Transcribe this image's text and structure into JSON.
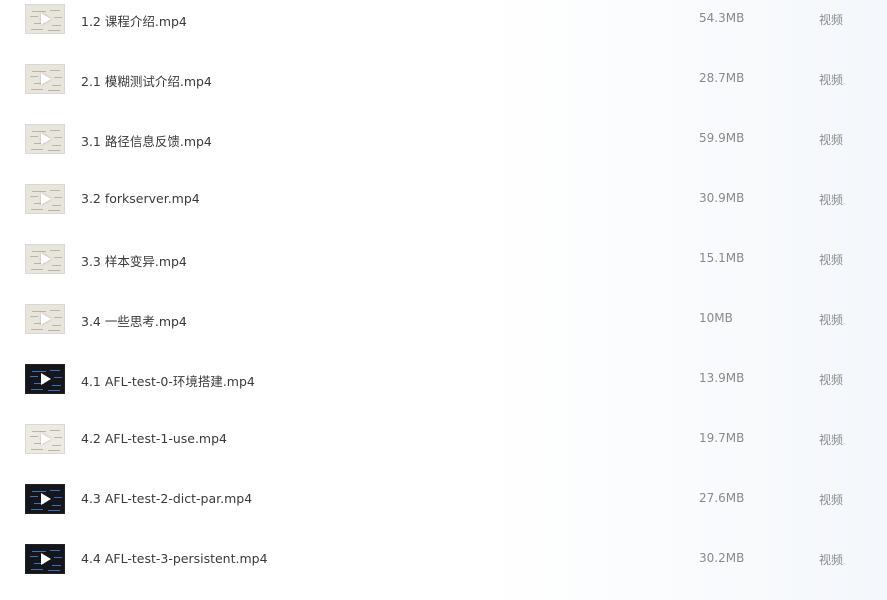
{
  "files": [
    {
      "name": "1.2 课程介绍.mp4",
      "size": "54.3MB",
      "type": "视频",
      "thumb": "light",
      "icon": "video-thumbnail-icon"
    },
    {
      "name": "2.1 模糊测试介绍.mp4",
      "size": "28.7MB",
      "type": "视频",
      "thumb": "light",
      "icon": "video-thumbnail-icon"
    },
    {
      "name": "3.1 路径信息反馈.mp4",
      "size": "59.9MB",
      "type": "视频",
      "thumb": "light",
      "icon": "video-thumbnail-icon"
    },
    {
      "name": "3.2 forkserver.mp4",
      "size": "30.9MB",
      "type": "视频",
      "thumb": "light",
      "icon": "video-thumbnail-icon"
    },
    {
      "name": "3.3 样本变异.mp4",
      "size": "15.1MB",
      "type": "视频",
      "thumb": "light",
      "icon": "video-thumbnail-icon"
    },
    {
      "name": "3.4 一些思考.mp4",
      "size": "10MB",
      "type": "视频",
      "thumb": "light",
      "icon": "video-thumbnail-icon"
    },
    {
      "name": "4.1 AFL-test-0-环境搭建.mp4",
      "size": "13.9MB",
      "type": "视频",
      "thumb": "dark",
      "icon": "video-thumbnail-icon"
    },
    {
      "name": "4.2 AFL-test-1-use.mp4",
      "size": "19.7MB",
      "type": "视频",
      "thumb": "light2",
      "icon": "video-thumbnail-icon"
    },
    {
      "name": "4.3 AFL-test-2-dict-par.mp4",
      "size": "27.6MB",
      "type": "视频",
      "thumb": "dark",
      "icon": "video-thumbnail-icon"
    },
    {
      "name": "4.4 AFL-test-3-persistent.mp4",
      "size": "30.2MB",
      "type": "视频",
      "thumb": "dark",
      "icon": "video-thumbnail-icon"
    }
  ]
}
